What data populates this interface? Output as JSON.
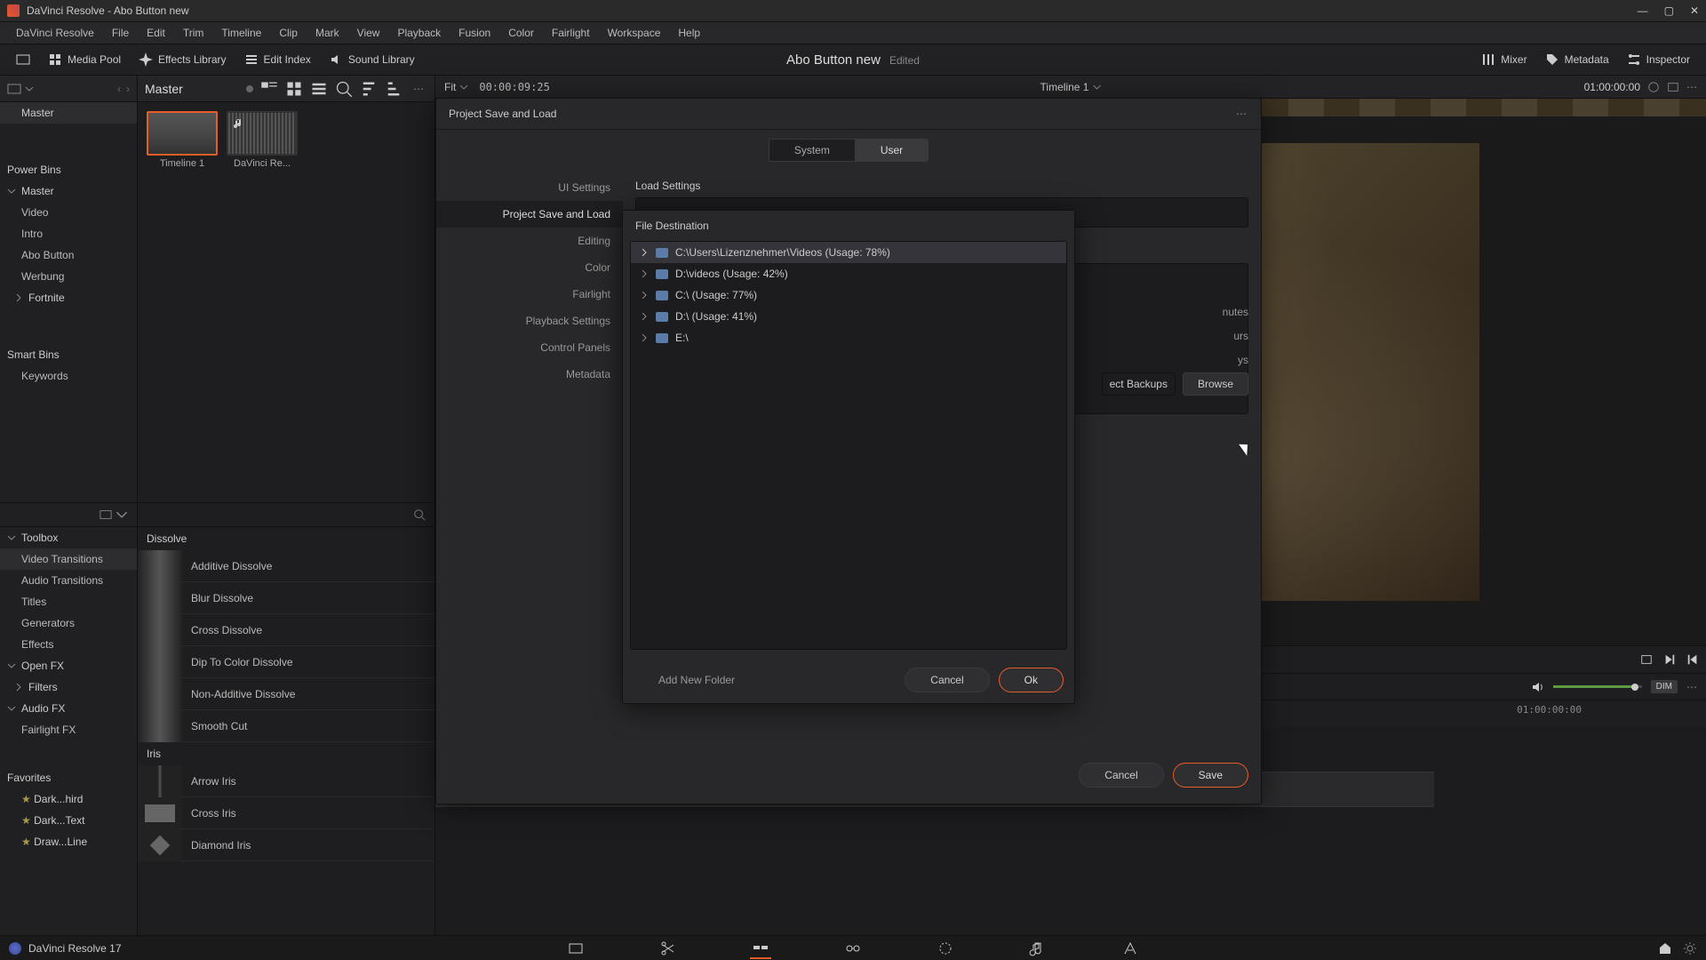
{
  "titlebar": {
    "text": "DaVinci Resolve - Abo Button new"
  },
  "menubar": [
    "DaVinci Resolve",
    "File",
    "Edit",
    "Trim",
    "Timeline",
    "Clip",
    "Mark",
    "View",
    "Playback",
    "Fusion",
    "Color",
    "Fairlight",
    "Workspace",
    "Help"
  ],
  "toolrow": {
    "media_pool": "Media Pool",
    "effects_library": "Effects Library",
    "edit_index": "Edit Index",
    "sound_library": "Sound Library",
    "project_name": "Abo Button new",
    "project_status": "Edited",
    "mixer": "Mixer",
    "metadata": "Metadata",
    "inspector": "Inspector"
  },
  "left_panel": {
    "root": "Master",
    "power_bins": "Power Bins",
    "master_expanded": "Master",
    "bins": [
      "Video",
      "Intro",
      "Abo Button",
      "Werbung",
      "Fortnite"
    ],
    "smart_bins": "Smart Bins",
    "smart_items": [
      "Keywords"
    ]
  },
  "thumbs_bar": {
    "master": "Master",
    "fit": "Fit",
    "tc_left": "00:00:09:25",
    "timeline_name": "Timeline 1",
    "tc_right": "01:00:00:00"
  },
  "thumbs": [
    {
      "label": "Timeline 1",
      "kind": "tl",
      "selected": true
    },
    {
      "label": "DaVinci Re...",
      "kind": "au",
      "selected": false
    }
  ],
  "fx_tree": {
    "search": "",
    "toolbox": "Toolbox",
    "items": [
      "Video Transitions",
      "Audio Transitions",
      "Titles",
      "Generators",
      "Effects"
    ],
    "openfx": "Open FX",
    "openfx_items": [
      "Filters"
    ],
    "audiofx": "Audio FX",
    "audiofx_items": [
      "Fairlight FX"
    ],
    "favorites": "Favorites",
    "fav_items": [
      "Dark...hird",
      "Dark...Text",
      "Draw...Line"
    ]
  },
  "fx_list": {
    "group1": "Dissolve",
    "items1": [
      "Additive Dissolve",
      "Blur Dissolve",
      "Cross Dissolve",
      "Dip To Color Dissolve",
      "Non-Additive Dissolve",
      "Smooth Cut"
    ],
    "group2": "Iris",
    "items2": [
      "Arrow Iris",
      "Cross Iris",
      "Diamond Iris"
    ]
  },
  "vol": {
    "dim": "DIM"
  },
  "ruler_tc": "01:00:00:00",
  "modal": {
    "title": "Project Save and Load",
    "tab_system": "System",
    "tab_user": "User",
    "side": [
      "UI Settings",
      "Project Save and Load",
      "Editing",
      "Color",
      "Fairlight",
      "Playback Settings",
      "Control Panels",
      "Metadata"
    ],
    "side_active_idx": 1,
    "load_settings": "Load Settings",
    "peek": [
      "nutes",
      "urs",
      "ys",
      "ect Backups"
    ],
    "browse": "Browse",
    "cancel": "Cancel",
    "save": "Save"
  },
  "file_modal": {
    "title": "File Destination",
    "rows": [
      {
        "label": "C:\\Users\\Lizenznehmer\\Videos (Usage: 78%)",
        "sel": true
      },
      {
        "label": "D:\\videos (Usage: 42%)",
        "sel": false
      },
      {
        "label": "C:\\ (Usage: 77%)",
        "sel": false
      },
      {
        "label": "D:\\ (Usage: 41%)",
        "sel": false
      },
      {
        "label": "E:\\",
        "sel": false
      }
    ],
    "add": "Add New Folder",
    "cancel": "Cancel",
    "ok": "Ok"
  },
  "footer": {
    "app": "DaVinci Resolve 17"
  }
}
